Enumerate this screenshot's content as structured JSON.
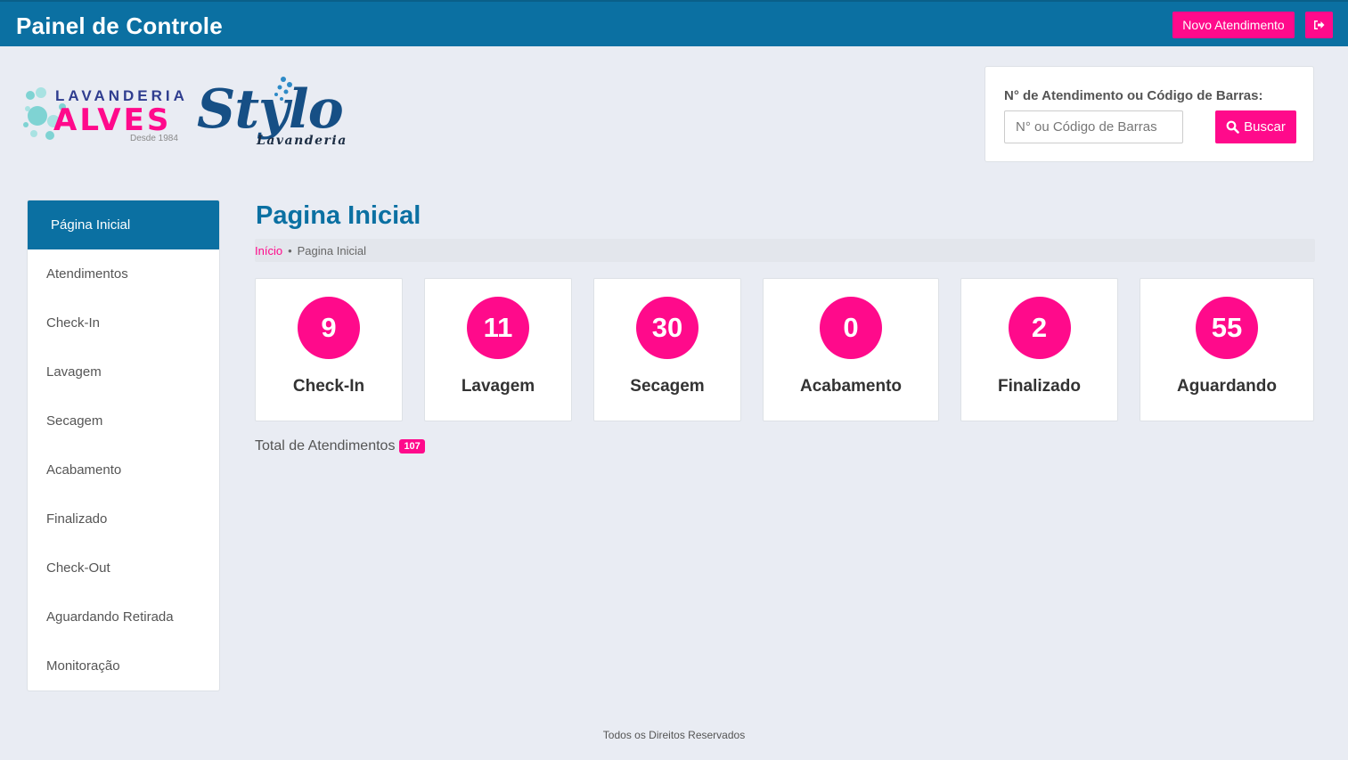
{
  "header": {
    "title": "Painel de Controle",
    "new_button": "Novo Atendimento",
    "logout_icon": "sign-out-icon"
  },
  "logo": {
    "alves_top": "LAVANDERIA",
    "alves_main": "ALVES",
    "alves_since": "Desde 1984",
    "stylo_main": "Stylo",
    "stylo_sub": "Lavanderia"
  },
  "search": {
    "label": "N° de Atendimento ou Código de Barras:",
    "placeholder": "N° ou Código de Barras",
    "value": "",
    "button": "Buscar",
    "button_icon": "search-icon"
  },
  "sidebar": {
    "items": [
      {
        "label": "Página Inicial",
        "active": true
      },
      {
        "label": "Atendimentos"
      },
      {
        "label": "Check-In"
      },
      {
        "label": "Lavagem"
      },
      {
        "label": "Secagem"
      },
      {
        "label": "Acabamento"
      },
      {
        "label": "Finalizado"
      },
      {
        "label": "Check-Out"
      },
      {
        "label": "Aguardando Retirada"
      },
      {
        "label": "Monitoração"
      }
    ]
  },
  "main": {
    "title": "Pagina Inicial",
    "breadcrumb": {
      "home": "Início",
      "separator": "•",
      "current": "Pagina Inicial"
    },
    "stats": [
      {
        "value": "9",
        "label": "Check-In"
      },
      {
        "value": "11",
        "label": "Lavagem"
      },
      {
        "value": "30",
        "label": "Secagem"
      },
      {
        "value": "0",
        "label": "Acabamento"
      },
      {
        "value": "2",
        "label": "Finalizado"
      },
      {
        "value": "55",
        "label": "Aguardando"
      }
    ],
    "total_label": "Total de Atendimentos",
    "total_value": "107"
  },
  "footer": {
    "text": "Todos os Direitos Reservados"
  },
  "colors": {
    "primary": "#0b70a2",
    "accent": "#ff0a8b",
    "background": "#e9ecf3"
  }
}
